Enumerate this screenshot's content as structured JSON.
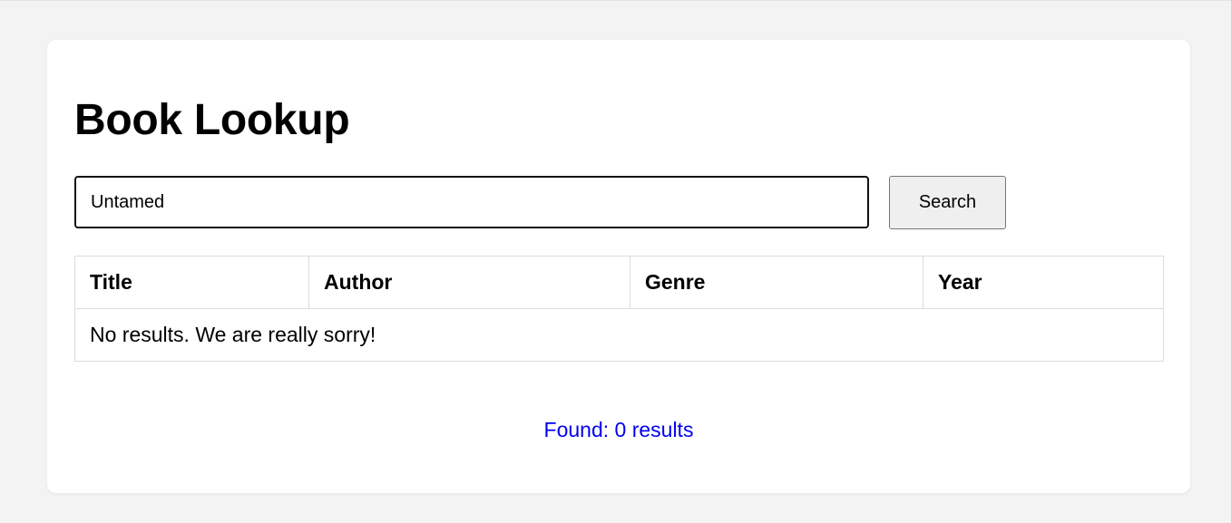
{
  "page": {
    "title": "Book Lookup"
  },
  "search": {
    "value": "Untamed",
    "button_label": "Search"
  },
  "table": {
    "columns": [
      "Title",
      "Author",
      "Genre",
      "Year"
    ],
    "empty_message": "No results. We are really sorry!"
  },
  "status": {
    "found_text": "Found: 0 results",
    "color": "#0000ee"
  },
  "colors": {
    "background": "#f3f3f3",
    "card": "#ffffff",
    "border": "#dcdcdc"
  }
}
